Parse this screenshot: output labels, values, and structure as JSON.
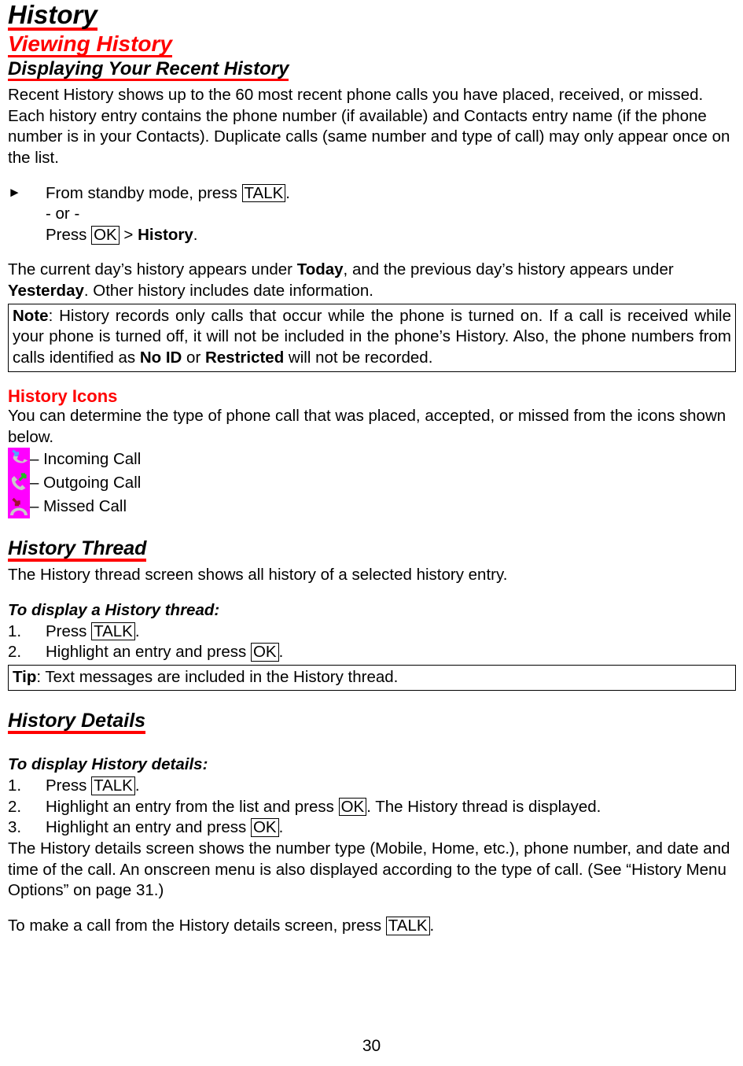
{
  "headings": {
    "title": "History",
    "subtitle": "Viewing History",
    "sub3": "Displaying Your Recent History",
    "history_icons": "History Icons",
    "history_thread": "History Thread",
    "history_details": "History Details"
  },
  "intro": {
    "text": "Recent History shows up to the 60 most recent phone calls you have placed, received, or missed. Each history entry contains the phone number (if available) and Contacts entry name (if the phone number is in your Contacts). Duplicate calls (same number and type of call) may only appear once on the list."
  },
  "standby_steps": {
    "marker": "►",
    "line1_pre": "From standby mode, press ",
    "line1_key": "TALK",
    "line1_post": ".",
    "line2": "- or -",
    "line3_pre": "Press ",
    "line3_key": "OK",
    "line3_mid": " > ",
    "line3_bold": "History",
    "line3_post": "."
  },
  "today_paragraph": {
    "part1": "The current day’s history appears under ",
    "bold1": "Today",
    "part2": ", and the previous day’s history appears under ",
    "bold2": "Yesterday",
    "part3": ". Other history includes date information."
  },
  "note_box": {
    "label": "Note",
    "part1": ": History records only calls that occur while the phone is turned on. If a call is received while your phone is turned off, it will not be included in the phone’s History. Also, the phone numbers from calls identified as ",
    "bold1": "No ID",
    "part2": " or ",
    "bold2": "Restricted",
    "part3": " will not be recorded."
  },
  "icons_intro": "You can determine the type of phone call that was placed, accepted, or missed from the icons shown below.",
  "call_icons": [
    {
      "icon_name": "incoming-call-icon",
      "label": "– Incoming Call",
      "arrow_color": "#4da6ff",
      "background": "#ff00ff",
      "handset_color": "#c9c9c9"
    },
    {
      "icon_name": "outgoing-call-icon",
      "label": "– Outgoing Call",
      "arrow_color": "#22bb22",
      "background": "#ff00ff",
      "handset_color": "#c9c9c9"
    },
    {
      "icon_name": "missed-call-icon",
      "label": "– Missed Call",
      "arrow_color": "#a01030",
      "background": "#ff00ff",
      "handset_color": "#c9c9c9"
    }
  ],
  "thread_section": {
    "intro": "The History thread screen shows all history of a selected history entry.",
    "howto_title": "To display a History thread:",
    "steps": [
      {
        "number": "1.",
        "pre": "Press ",
        "key": "TALK",
        "post": "."
      },
      {
        "number": "2.",
        "pre": "Highlight an entry and press ",
        "key": "OK",
        "post": "."
      }
    ]
  },
  "tip_box": {
    "label": "Tip",
    "text": ": Text messages are included in the History thread."
  },
  "details_section": {
    "howto_title": "To display History details:",
    "steps": [
      {
        "number": "1.",
        "pre": "Press ",
        "key": "TALK",
        "post": "."
      },
      {
        "number": "2.",
        "pre": "Highlight an entry from the list and press ",
        "key": "OK",
        "post": ". The History thread is displayed."
      },
      {
        "number": "3.",
        "pre": "Highlight an entry and press ",
        "key": "OK",
        "post": "."
      }
    ],
    "paragraph": "The History details screen shows the number type (Mobile, Home, etc.), phone number, and date and time of the call. An onscreen menu is also displayed according to the type of call. (See “History Menu Options” on page 31.)",
    "closing_pre": "To make a call from the History details screen, press ",
    "closing_key": "TALK",
    "closing_post": "."
  },
  "page_number": "30"
}
